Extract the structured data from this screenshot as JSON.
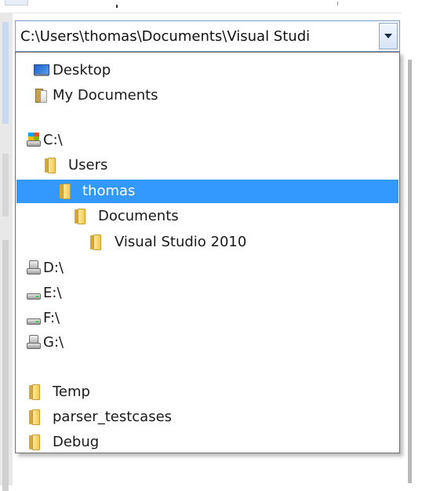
{
  "combo": {
    "path_value": "C:\\Users\\thomas\\Documents\\Visual Studi"
  },
  "dropdown": {
    "items": [
      {
        "label": "Desktop",
        "icon": "desktop-icon"
      },
      {
        "label": "My Documents",
        "icon": "documents-icon"
      },
      {
        "label": "C:\\",
        "icon": "system-drive-icon"
      },
      {
        "label": "Users",
        "icon": "folder-icon"
      },
      {
        "label": "thomas",
        "icon": "folder-icon",
        "selected": true
      },
      {
        "label": "Documents",
        "icon": "folder-icon"
      },
      {
        "label": "Visual Studio 2010",
        "icon": "folder-icon"
      },
      {
        "label": "D:\\",
        "icon": "network-drive-icon"
      },
      {
        "label": "E:\\",
        "icon": "drive-icon"
      },
      {
        "label": "F:\\",
        "icon": "drive-icon"
      },
      {
        "label": "G:\\",
        "icon": "network-drive-icon"
      },
      {
        "label": "Temp",
        "icon": "folder-icon"
      },
      {
        "label": "parser_testcases",
        "icon": "folder-icon"
      },
      {
        "label": "Debug",
        "icon": "folder-icon"
      }
    ]
  },
  "colors": {
    "selection": "#3399ff",
    "selection_text": "#ffffff",
    "border": "#6e6e6e"
  }
}
